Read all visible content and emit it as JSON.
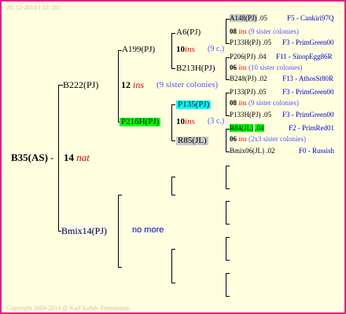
{
  "header": {
    "date": "28. 12-2014 ( 22: 20)"
  },
  "footer": {
    "copyright": "Copyright 2004-2014 @ Karl Kehde Foundation."
  },
  "colors": {
    "border": "#e0208a",
    "background": "#ffffe0",
    "ins_red": "#e00000",
    "link_blue": "#0000cc",
    "highlight_green": "#00ff00",
    "highlight_cyan": "#00ffff",
    "highlight_grey": "#c8c8c8"
  },
  "tree": {
    "root": {
      "name": "B35(AS)",
      "year": "14",
      "tag": "nat"
    },
    "dam": {
      "name": "B222(PJ)",
      "year": "12",
      "tag": "ins",
      "colonies": "(9 sister colonies)"
    },
    "drone_side": {
      "name": "Bmix14(PJ)",
      "note": "no more"
    },
    "g3a": {
      "name": "A199(PJ)"
    },
    "g3b": {
      "name": "P216H(PJ)",
      "year": "10",
      "tag": "ins",
      "colonies": "(3 c.)"
    },
    "g4a": {
      "name": "A6(PJ)",
      "year": "10",
      "tag": "ins",
      "colonies": "(9 c.)"
    },
    "g4b": {
      "name": "B213H(PJ)"
    },
    "g4c": {
      "name": "P135(PJ)"
    },
    "g4d": {
      "name": "R85(JL)"
    },
    "g5": [
      {
        "name": "A148(PJ)",
        "year": ".05",
        "ref": "F5 - Cankiri97Q"
      },
      {
        "line2_year": "08",
        "tag": "ins",
        "colonies": "(9 sister colonies)"
      },
      {
        "name": "P133H(PJ)",
        "year": ".05",
        "ref": "F3 - PrimGreen00"
      },
      {
        "name": "P206(PJ)",
        "year": ".04",
        "ref": "F11 - SinopEgg86R"
      },
      {
        "line2_year": "06",
        "tag": "ins",
        "colonies": "(10 sister colonies)"
      },
      {
        "name": "B248(PJ)",
        "year": ".02",
        "ref": "F13 - AthosSt80R"
      },
      {
        "name": "P133(PJ)",
        "year": ".05",
        "ref": "F3 - PrimGreen00"
      },
      {
        "line2_year": "08",
        "tag": "ins",
        "colonies": "(9 sister colonies)"
      },
      {
        "name": "P133H(PJ)",
        "year": ".05",
        "ref": "F3 - PrimGreen00"
      },
      {
        "name": "R84(JL)",
        "year": ".04",
        "ref": "F2 - PrimRed01"
      },
      {
        "line2_year": "06",
        "tag": "ins",
        "colonies": "(2x3 sister colonies)"
      },
      {
        "name": "Bmix06(JL)",
        "year": ".02",
        "ref": "F0 - Russish"
      }
    ]
  }
}
